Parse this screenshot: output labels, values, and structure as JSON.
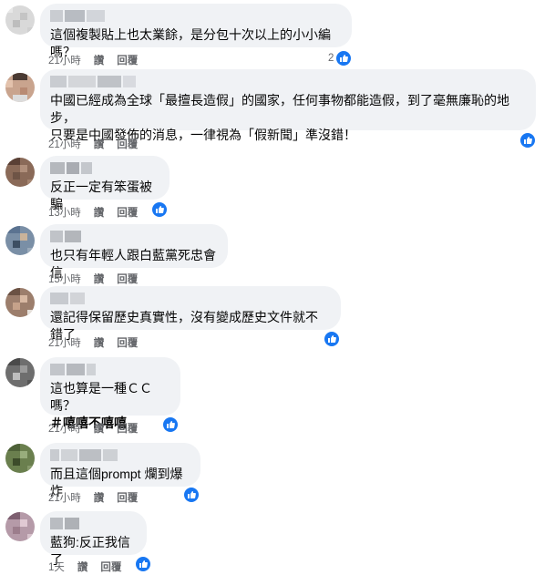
{
  "colors": {
    "like": "#1877f2",
    "bubble": "#f0f2f5",
    "meta": "#65676b"
  },
  "comments": [
    {
      "lines": [
        "這個複製貼上也太業餘，是分包十次以上的小小編嗎？"
      ],
      "time": "21小時",
      "like_label": "讚",
      "reply_label": "回覆",
      "reaction_count": "2",
      "reaction_icon": "like-icon"
    },
    {
      "lines": [
        "中國已經成為全球「最擅長造假」的國家，任何事物都能造假，到了毫無廉恥的地步，",
        "只要是中國發佈的消息，一律視為「假新聞」準沒錯！"
      ],
      "time": "21小時",
      "like_label": "讚",
      "reply_label": "回覆",
      "reaction_icon": "like-icon"
    },
    {
      "lines": [
        "反正一定有笨蛋被騙"
      ],
      "time": "13小時",
      "like_label": "讚",
      "reply_label": "回覆",
      "reaction_icon": "like-icon"
    },
    {
      "lines": [
        "也只有年輕人跟白藍黨死忠會信"
      ],
      "time": "15小時",
      "like_label": "讚",
      "reply_label": "回覆"
    },
    {
      "lines": [
        "還記得保留歷史真實性，沒有變成歷史文件就不錯了"
      ],
      "time": "21小時",
      "like_label": "讚",
      "reply_label": "回覆",
      "reaction_icon": "like-icon"
    },
    {
      "lines": [
        "這也算是一種ＣＣ嗎？"
      ],
      "hashtag": "＃嘻嘻不嘻嘻",
      "time": "21小時",
      "like_label": "讚",
      "reply_label": "回覆",
      "reaction_icon": "like-icon"
    },
    {
      "lines": [
        "而且這個prompt 爛到爆炸"
      ],
      "time": "21小時",
      "like_label": "讚",
      "reply_label": "回覆",
      "reaction_icon": "like-icon"
    },
    {
      "lines": [
        "藍狗:反正我信了"
      ],
      "time": "1天",
      "like_label": "讚",
      "reply_label": "回覆",
      "reaction_icon": "like-icon"
    }
  ]
}
